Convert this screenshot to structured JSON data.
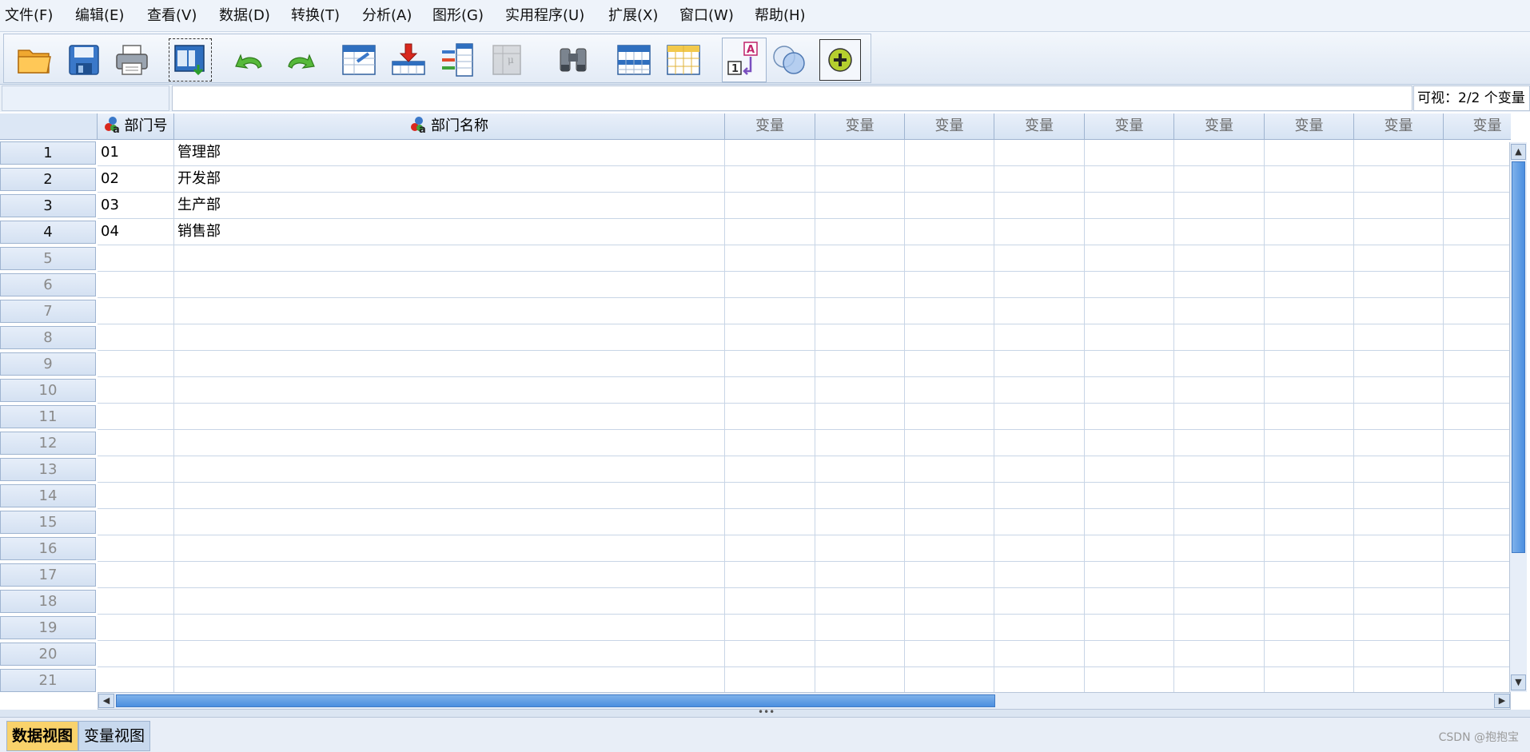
{
  "menu": [
    {
      "label": "文件(F)"
    },
    {
      "label": "编辑(E)"
    },
    {
      "label": "查看(V)"
    },
    {
      "label": "数据(D)"
    },
    {
      "label": "转换(T)"
    },
    {
      "label": "分析(A)"
    },
    {
      "label": "图形(G)"
    },
    {
      "label": "实用程序(U)"
    },
    {
      "label": "扩展(X)"
    },
    {
      "label": "窗口(W)"
    },
    {
      "label": "帮助(H)"
    }
  ],
  "toolbar": {
    "icons": [
      "open-folder-icon",
      "save-icon",
      "print-icon",
      "recall-dialog-icon",
      "undo-icon",
      "redo-icon",
      "goto-case-icon",
      "goto-variable-icon",
      "variables-icon",
      "run-descriptives-icon",
      "find-icon",
      "insert-cases-icon",
      "insert-variable-icon",
      "value-labels-icon",
      "use-sets-icon",
      "custom-dialog-icon"
    ]
  },
  "editbar": {
    "cell_ref": "",
    "cell_value": "",
    "visible_count": "可视：2/2 个变量"
  },
  "grid": {
    "columns": [
      {
        "label": "部门号",
        "type": "nominal-string"
      },
      {
        "label": "部门名称",
        "type": "nominal-string"
      },
      {
        "label": "变量"
      },
      {
        "label": "变量"
      },
      {
        "label": "变量"
      },
      {
        "label": "变量"
      },
      {
        "label": "变量"
      },
      {
        "label": "变量"
      },
      {
        "label": "变量"
      },
      {
        "label": "变量"
      },
      {
        "label": "变量"
      }
    ],
    "rows": [
      {
        "num": "1",
        "cells": [
          "01",
          "管理部"
        ]
      },
      {
        "num": "2",
        "cells": [
          "02",
          "开发部"
        ]
      },
      {
        "num": "3",
        "cells": [
          "03",
          "生产部"
        ]
      },
      {
        "num": "4",
        "cells": [
          "04",
          "销售部"
        ]
      },
      {
        "num": "5",
        "cells": []
      },
      {
        "num": "6",
        "cells": []
      },
      {
        "num": "7",
        "cells": []
      },
      {
        "num": "8",
        "cells": []
      },
      {
        "num": "9",
        "cells": []
      },
      {
        "num": "10",
        "cells": []
      },
      {
        "num": "11",
        "cells": []
      },
      {
        "num": "12",
        "cells": []
      },
      {
        "num": "13",
        "cells": []
      },
      {
        "num": "14",
        "cells": []
      },
      {
        "num": "15",
        "cells": []
      },
      {
        "num": "16",
        "cells": []
      },
      {
        "num": "17",
        "cells": []
      },
      {
        "num": "18",
        "cells": []
      },
      {
        "num": "19",
        "cells": []
      },
      {
        "num": "20",
        "cells": []
      },
      {
        "num": "21",
        "cells": []
      }
    ]
  },
  "tabs": {
    "data_view": "数据视图",
    "variable_view": "变量视图"
  },
  "watermark": "CSDN @抱抱宝",
  "colors": {
    "accent": "#4b8fe0",
    "active_tab": "#f9d26b",
    "header_bg": "#d6e3f3"
  }
}
